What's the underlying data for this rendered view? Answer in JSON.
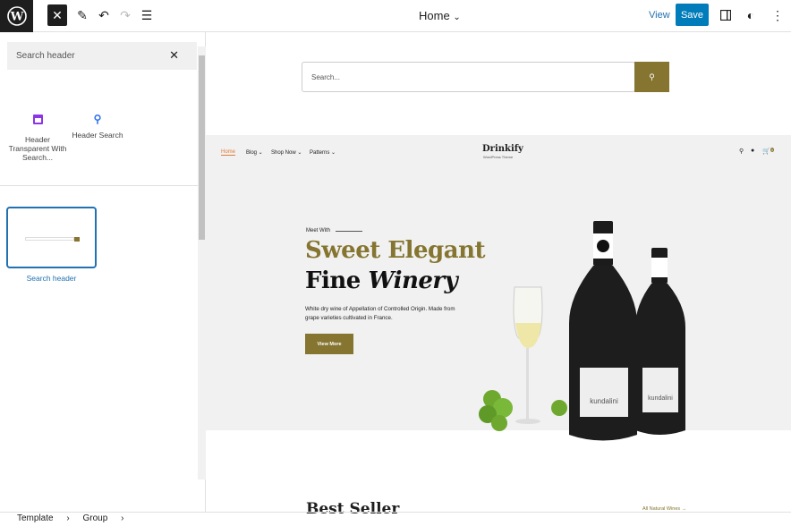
{
  "toolbar": {
    "close": "✕",
    "title": "Home",
    "view": "View",
    "save": "Save"
  },
  "sidebar": {
    "search_placeholder": "Search header",
    "items": [
      {
        "label": "Header Transparent With Search...",
        "icon": "layout-icon",
        "color": "#8d35e6"
      },
      {
        "label": "Header Search",
        "icon": "search-icon",
        "color": "#2d6ff0"
      }
    ],
    "pattern": "Search header"
  },
  "breadcrumb": [
    "Template",
    "Group"
  ],
  "canvas": {
    "search_placeholder": "Search...",
    "accent": "#857530",
    "nav": [
      "Home",
      "Blog",
      "Shop Now",
      "Patterns"
    ],
    "brand": "Drinkify",
    "brand_sub": "WordPress Theme",
    "cart_count": "0",
    "hero": {
      "eyebrow": "Meet With",
      "line1": "Sweet Elegant",
      "line2a": "Fine",
      "line2b": "Winery",
      "desc": "White dry wine of Appellation of Controlled Origin. Made from grape varieties cultivated in France.",
      "button": "View More",
      "bottle_label": "kundalini"
    },
    "best_seller": "Best Seller",
    "all_wines": "All Natural Wines →"
  }
}
